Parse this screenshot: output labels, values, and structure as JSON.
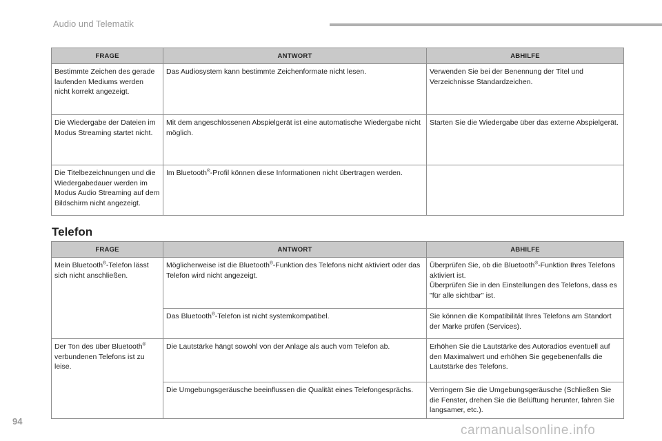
{
  "header": {
    "title": "Audio und Telematik"
  },
  "table1": {
    "headers": [
      "FRAGE",
      "ANTWORT",
      "ABHILFE"
    ],
    "rows": [
      {
        "q": "Bestimmte Zeichen des gerade laufenden Mediums werden nicht korrekt angezeigt.",
        "a": "Das Audiosystem kann bestimmte Zeichenformate nicht lesen.",
        "r": "Verwenden Sie bei der Benennung der Titel und Verzeichnisse Standardzeichen."
      },
      {
        "q": "Die Wiedergabe der Dateien im Modus Streaming startet nicht.",
        "a": "Mit dem angeschlossenen Abspielgerät ist eine automatische Wiedergabe nicht möglich.",
        "r": "Starten Sie die Wiedergabe über das externe Abspielgerät."
      },
      {
        "q": "Die Titelbezeichnungen und die Wiedergabedauer werden im Modus Audio Streaming auf dem Bildschirm nicht angezeigt.",
        "a_pre": "Im Bluetooth",
        "a_post": "-Profil können diese Informationen nicht übertragen werden.",
        "r": ""
      }
    ]
  },
  "section": {
    "title": "Telefon"
  },
  "table2": {
    "headers": [
      "FRAGE",
      "ANTWORT",
      "ABHILFE"
    ],
    "q1_pre": "Mein Bluetooth",
    "q1_post": "-Telefon lässt sich nicht anschließen.",
    "a1_pre": "Möglicherweise ist die Bluetooth",
    "a1_post": "-Funktion des Telefons nicht aktiviert oder das Telefon wird nicht angezeigt.",
    "r1_pre": "Überprüfen Sie, ob die Bluetooth",
    "r1_mid": "-Funktion Ihres Telefons aktiviert ist.",
    "r1_line2": "Überprüfen Sie in den Einstellungen des Telefons, dass es \"für alle sichtbar\" ist.",
    "a2_pre": "Das Bluetooth",
    "a2_post": "-Telefon ist nicht systemkompatibel.",
    "r2": "Sie können die Kompatibilität Ihres Telefons am Standort der Marke prüfen (Services).",
    "q2_pre": "Der Ton des über Bluetooth",
    "q2_post": "verbundenen Telefons ist zu leise.",
    "a3": "Die Lautstärke hängt sowohl von der Anlage als auch vom Telefon ab.",
    "r3": "Erhöhen Sie die Lautstärke des Autoradios eventuell auf den Maximalwert und erhöhen Sie gegebenenfalls die Lautstärke des Telefons.",
    "a4": "Die Umgebungsgeräusche beeinflussen die Qualität eines Telefongesprächs.",
    "r4": "Verringern Sie die Umgebungsgeräusche (Schließen Sie die Fenster, drehen Sie die Belüftung herunter, fahren Sie langsamer, etc.)."
  },
  "registered_mark": "®",
  "page_number": "94",
  "watermark": "carmanualsonline.info"
}
